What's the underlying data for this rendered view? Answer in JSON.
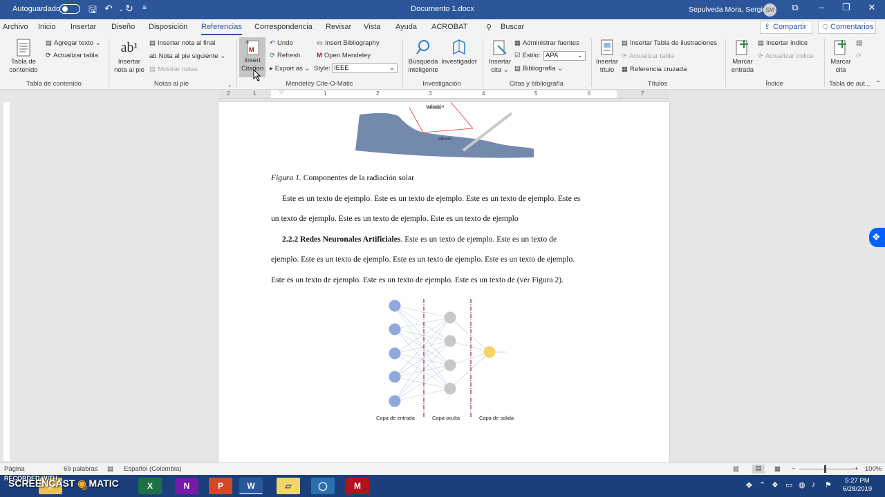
{
  "titlebar": {
    "autosave_label": "Autoguardado",
    "doc_title": "Documento 1.docx",
    "search_label": "Buscar",
    "user_name": "Sepulveda Mora, Sergio",
    "user_initials": "SM"
  },
  "tabs": [
    "Archivo",
    "Inicio",
    "Insertar",
    "Diseño",
    "Disposición",
    "Referencias",
    "Correspondencia",
    "Revisar",
    "Vista",
    "Ayuda",
    "ACROBAT"
  ],
  "active_tab": "Referencias",
  "share_label": "Compartir",
  "comments_label": "Comentarios",
  "ribbon": {
    "toc": {
      "tabla_contenido": "Tabla de contenido",
      "agregar_texto": "Agregar texto",
      "actualizar_tabla": "Actualizar tabla",
      "group": "Tabla de contenido"
    },
    "notes": {
      "insertar_nota": "Insertar nota al pie",
      "nota_final": "Insertar nota al final",
      "nota_siguiente": "Nota al pie siguiente",
      "mostrar_notas": "Mostrar notas",
      "group": "Notas al pie"
    },
    "mendeley": {
      "insert_citation": "Insert Citation",
      "undo": "Undo",
      "refresh": "Refresh",
      "export_as": "Export as",
      "insert_bibliography": "Insert Bibliography",
      "open_mendeley": "Open Mendeley",
      "style_label": "Style:",
      "style_value": "IEEE",
      "group": "Mendeley Cite-O-Matic"
    },
    "research": {
      "busqueda": "Búsqueda inteligente",
      "investigador": "Investigador",
      "group": "Investigación"
    },
    "citations": {
      "insertar_cita": "Insertar cita",
      "administrar": "Administrar fuentes",
      "estilo_label": "Estilo:",
      "estilo_value": "APA",
      "bibliografia": "Bibliografía",
      "group": "Citas y bibliografía"
    },
    "captions": {
      "insertar_titulo": "Insertar título",
      "tabla_ilustraciones": "Insertar Tabla de ilustraciones",
      "actualizar_tabla": "Actualizar tabla",
      "referencia_cruzada": "Referencia cruzada",
      "group": "Títulos"
    },
    "index": {
      "marcar_entrada": "Marcar entrada",
      "insertar_indice": "Insertar índice",
      "actualizar_indice": "Actualizar índice",
      "group": "Índice"
    },
    "authorities": {
      "marcar_cita": "Marcar cita",
      "group": "Tabla de aut..."
    }
  },
  "ruler_numbers": [
    "2",
    "1",
    "1",
    "2",
    "3",
    "4",
    "5",
    "6",
    "7"
  ],
  "document": {
    "figure1_labels": {
      "direct": "directa",
      "radiation": "radiación",
      "albedo": "albedo"
    },
    "figure1_caption_italic": "Figura 1.",
    "figure1_caption_text": " Componentes de la radiación solar",
    "para1_line1": "Este es un texto de ejemplo. Este es un texto de ejemplo. Este es un texto de ejemplo. Este es",
    "para1_line2": "un texto de ejemplo. Este es un texto de ejemplo. Este es un texto de ejemplo",
    "section_heading": "2.2.2 Redes Neuronales Artificiales",
    "para2_line1_rest": ". Este es un texto de ejemplo. Este es un texto de",
    "para2_line2": "ejemplo. Este es un texto de ejemplo. Este es un texto de ejemplo. Este es un texto de ejemplo.",
    "para2_line3": "Este es un texto de ejemplo. Este es un texto de ejemplo. Este es un texto de (ver Figura 2).",
    "figure2_labels": {
      "input": "Capa de entrada",
      "hidden": "Capa oculta",
      "output": "Capa de salida"
    }
  },
  "statusbar": {
    "page": "Página",
    "words": "69 palabras",
    "language": "Español (Colombia)",
    "zoom": "100%"
  },
  "watermark": {
    "recorded": "RECORDED WITH",
    "brand_left": "SCREENCAST",
    "brand_right": "MATIC"
  },
  "clock": {
    "time": "5:27 PM",
    "date": "6/28/2019"
  },
  "colors": {
    "word_blue": "#2b579a",
    "neuron_blue": "#8fa8dd",
    "neuron_gray": "#c8c8c8",
    "neuron_yellow": "#f6d36b",
    "divider_red": "#a01e2e",
    "land": "#7389ad"
  }
}
